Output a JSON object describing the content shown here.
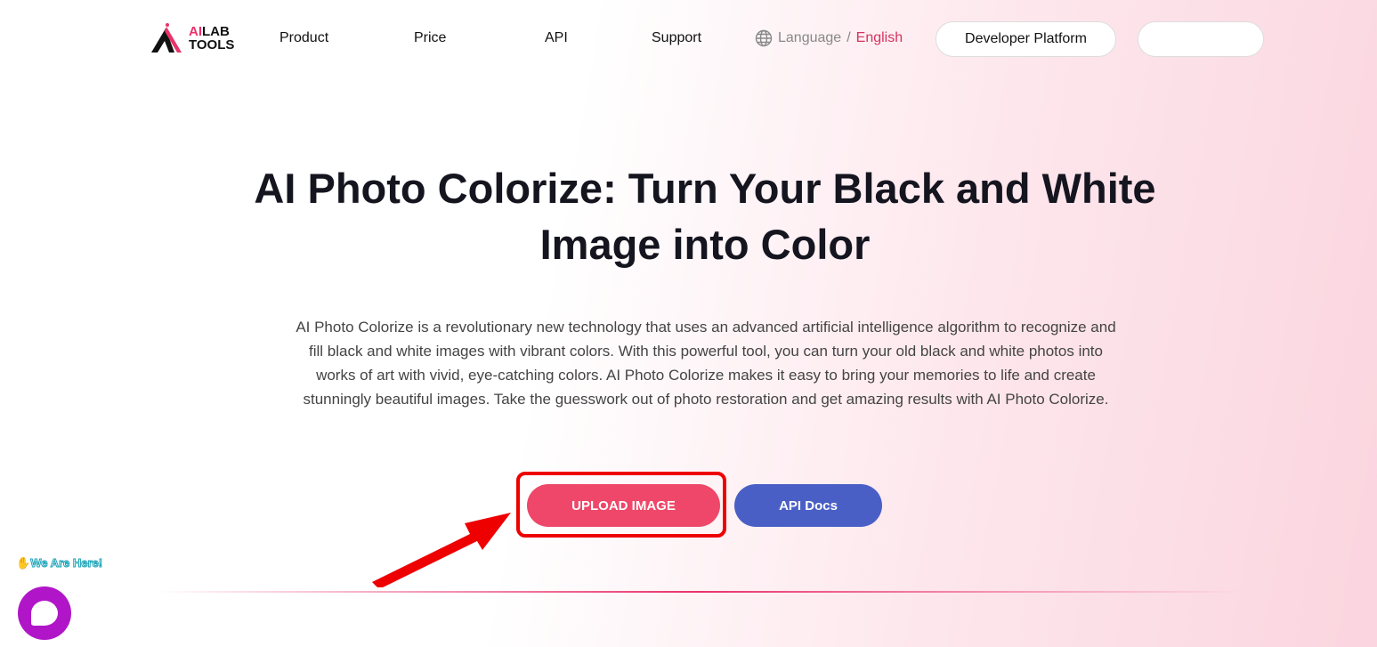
{
  "header": {
    "logo": {
      "line1_accent": "AI",
      "line1_rest": "LAB",
      "line2": "TOOLS"
    },
    "nav": [
      {
        "label": "Product"
      },
      {
        "label": "Price"
      },
      {
        "label": "API"
      },
      {
        "label": "Support"
      }
    ],
    "language": {
      "label": "Language",
      "separator": "/",
      "value": "English"
    },
    "developer_platform": "Developer Platform",
    "blank_button": ""
  },
  "hero": {
    "title_line1": "AI Photo Colorize: Turn Your Black and White",
    "title_line2": "Image into Color",
    "description": "AI Photo Colorize is a revolutionary new technology that uses an advanced artificial intelligence algorithm to recognize and fill black and white images with vibrant colors. With this powerful tool, you can turn your old black and white photos into works of art with vivid, eye-catching colors. AI Photo Colorize makes it easy to bring your memories to life and create stunningly beautiful images. Take the guesswork out of photo restoration and get amazing results with AI Photo Colorize.",
    "upload_button": "UPLOAD IMAGE",
    "api_docs_button": "API Docs"
  },
  "chat": {
    "tagline": "We Are Here!"
  },
  "colors": {
    "accent": "#ef4769",
    "api": "#4a5fc6",
    "highlight": "#e00000",
    "chat": "#b016c8"
  }
}
